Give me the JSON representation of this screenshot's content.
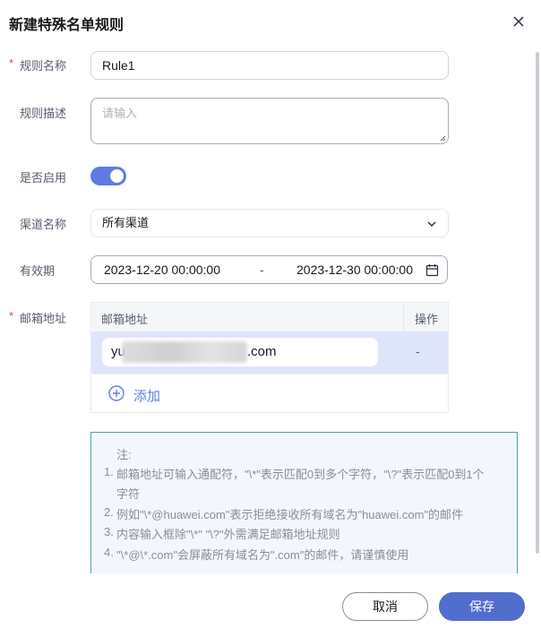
{
  "dialog": {
    "title": "新建特殊名单规则",
    "close_icon": "close-icon"
  },
  "form": {
    "rule_name": {
      "label": "规则名称",
      "required_mark": "*",
      "value": "Rule1"
    },
    "rule_desc": {
      "label": "规则描述",
      "placeholder": "请输入"
    },
    "enabled": {
      "label": "是否启用",
      "state": "on"
    },
    "channel": {
      "label": "渠道名称",
      "value": "所有渠道",
      "icon": "chevron-down-icon"
    },
    "validity": {
      "label": "有效期",
      "start": "2023-12-20 00:00:00",
      "separator": "-",
      "end": "2023-12-30 00:00:00",
      "icon": "calendar-icon"
    },
    "email": {
      "label": "邮箱地址",
      "required_mark": "*",
      "columns": [
        "邮箱地址",
        "操作"
      ],
      "rows": [
        {
          "prefix": "yu",
          "domain": ".com",
          "action": "-"
        }
      ],
      "add_label": "添加",
      "add_icon": "plus-circle-icon"
    }
  },
  "notice": {
    "head": "注:",
    "items": [
      {
        "num": "1.",
        "lines": [
          "邮箱地址可输入通配符，\"\\*\"表示匹配0到多个字符，\"\\?\"表示匹配0到1个",
          "字符"
        ]
      },
      {
        "num": "2.",
        "lines": [
          "例如\"\\*@huawei.com\"表示拒绝接收所有域名为\"huawei.com\"的邮件"
        ]
      },
      {
        "num": "3.",
        "lines": [
          "内容输入框除\"\\*\" \"\\?\"外需满足邮箱地址规则"
        ]
      },
      {
        "num": "4.",
        "lines": [
          "\"\\*@\\*.com\"会屏蔽所有域名为\".com\"的邮件，请谨慎使用"
        ]
      }
    ]
  },
  "footer": {
    "cancel_label": "取消",
    "save_label": "保存"
  },
  "colors": {
    "primary": "#526ecc",
    "toggle_on": "#5e7ce0",
    "required": "#e54545",
    "notice_border": "#52a39a"
  }
}
